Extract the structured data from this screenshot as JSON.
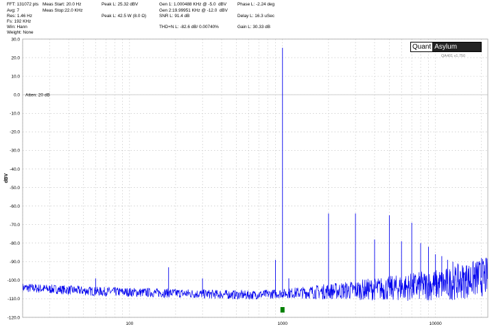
{
  "stats": {
    "col1": [
      "FFT: 131072 pts",
      "Avg: 7",
      "Res: 1.46 Hz",
      "Fs: 192 KHz",
      "Win: Hann",
      "Weight: None"
    ],
    "col2": [
      "Meas Start: 20.0 Hz",
      "Meas Stop:22.0 KHz"
    ],
    "col3": [
      "Peak L: 25.32 dBV",
      "",
      "Peak L: 42.5 W (8.0 Ω)"
    ],
    "col4": [
      "Gen 1: 1.000488 KHz @ -5.0  dBV",
      "Gen 2:19.99951 KHz @ -12.0  dBV",
      "SNR L: 91.4 dB",
      "",
      "THD+N L: -82.6 dB/ 0.00740%"
    ],
    "col5": [
      "Phase L: -2.24 deg",
      "",
      "Delay L: 16.3 uSec",
      "",
      "Gain L: 30.33 dB"
    ]
  },
  "logo": {
    "part1": "Quant",
    "part2": "Asylum",
    "version": "QA401 v1.750"
  },
  "colors": {
    "trace": "#0000ee",
    "grid": "#b8b8b8",
    "attenLine": "#c8c8c8",
    "marker": "#008000"
  },
  "chart_data": {
    "type": "line",
    "xscale": "log",
    "xlim": [
      20,
      22000
    ],
    "ylim": [
      -120,
      30
    ],
    "ylabel": "dBV",
    "xticklabels": [
      "100",
      "1000",
      "10000"
    ],
    "yticklabels": [
      "30.0",
      "20.0",
      "10.0",
      "0.0",
      "-10.0",
      "-20.0",
      "-30.0",
      "-40.0",
      "-50.0",
      "-60.0",
      "-70.0",
      "-80.0",
      "-90.0",
      "-100.0",
      "-110.0",
      "-120.0"
    ],
    "grid": true,
    "annotations": [
      {
        "text": "Atten: 20 dB",
        "y": 0
      }
    ],
    "marker": {
      "x": 1000
    },
    "noise_floor_dbv": [
      {
        "f": 20,
        "v": -104
      },
      {
        "f": 60,
        "v": -106
      },
      {
        "f": 200,
        "v": -107
      },
      {
        "f": 600,
        "v": -108
      },
      {
        "f": 2000,
        "v": -106
      },
      {
        "f": 6000,
        "v": -104
      },
      {
        "f": 12000,
        "v": -102
      },
      {
        "f": 22000,
        "v": -98
      }
    ],
    "series": [
      {
        "peaks": [
          {
            "f": 60,
            "v": -99
          },
          {
            "f": 180,
            "v": -93
          },
          {
            "f": 300,
            "v": -99
          },
          {
            "f": 900,
            "v": -89
          },
          {
            "f": 1000,
            "v": 25.3
          },
          {
            "f": 1100,
            "v": -99
          },
          {
            "f": 2000,
            "v": -64
          },
          {
            "f": 3000,
            "v": -64
          },
          {
            "f": 4000,
            "v": -78
          },
          {
            "f": 5000,
            "v": -65
          },
          {
            "f": 6000,
            "v": -79
          },
          {
            "f": 7000,
            "v": -69
          },
          {
            "f": 8000,
            "v": -80
          },
          {
            "f": 9000,
            "v": -82
          },
          {
            "f": 10000,
            "v": -86
          },
          {
            "f": 11000,
            "v": -87
          },
          {
            "f": 12000,
            "v": -89
          },
          {
            "f": 13000,
            "v": -90
          },
          {
            "f": 14000,
            "v": -91
          },
          {
            "f": 15000,
            "v": -92
          },
          {
            "f": 16000,
            "v": -92
          },
          {
            "f": 17000,
            "v": -93
          },
          {
            "f": 18000,
            "v": -93
          },
          {
            "f": 19000,
            "v": -90
          },
          {
            "f": 20000,
            "v": -88
          }
        ]
      }
    ]
  }
}
